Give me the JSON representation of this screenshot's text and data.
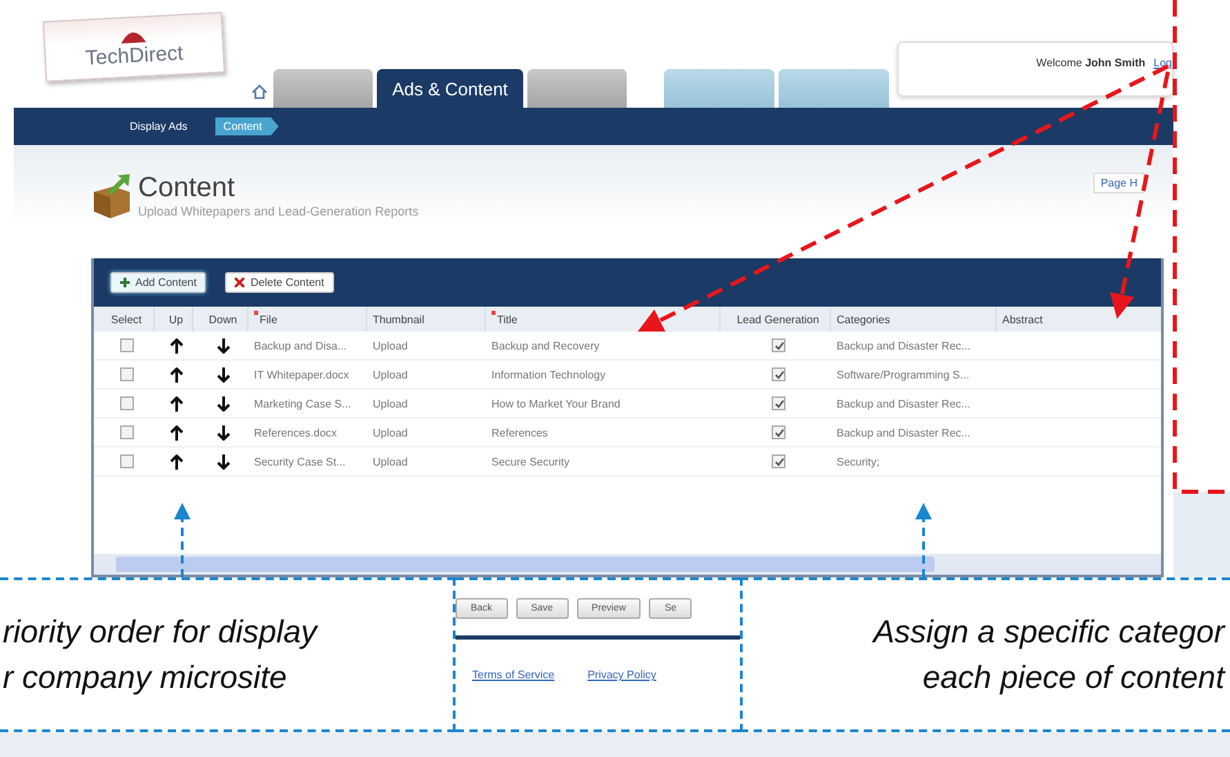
{
  "logo": {
    "text": "TechDirect"
  },
  "tabs": [
    {
      "kind": "grey",
      "selected": false
    },
    {
      "label": "Ads & Content",
      "kind": "grey",
      "selected": true
    },
    {
      "kind": "grey",
      "selected": false
    },
    {
      "kind": "faded",
      "selected": false
    },
    {
      "kind": "faded",
      "selected": false
    }
  ],
  "user_box": {
    "welcome": "Welcome **John Smith**",
    "link": "Log"
  },
  "subnav": [
    {
      "label": "Display Ads",
      "selected": false
    },
    {
      "label": "Content",
      "selected": true
    }
  ],
  "page": {
    "title": "Content",
    "subtitle": "Upload Whitepapers and Lead-Generation Reports",
    "help_link": "Page H"
  },
  "toolbar": [
    {
      "label": "Add Content",
      "kind": "add"
    },
    {
      "label": "Delete Content",
      "kind": "delete"
    }
  ],
  "table": {
    "columns": [
      {
        "label": "Select",
        "required": false
      },
      {
        "label": "Up",
        "required": false
      },
      {
        "label": "Down",
        "required": false
      },
      {
        "label": "File",
        "required": true
      },
      {
        "label": "Thumbnail",
        "required": false
      },
      {
        "label": "Title",
        "required": true
      },
      {
        "label": "Lead Generation",
        "required": false
      },
      {
        "label": "Categories",
        "required": false
      },
      {
        "label": "Abstract",
        "required": false
      }
    ],
    "rows": [
      {
        "checked": false,
        "file": "Backup and Disa...",
        "thumbnail": "Upload",
        "title": "Backup and Recovery",
        "lead_generation": true,
        "categories": "Backup and Disaster Rec..."
      },
      {
        "checked": false,
        "file": "IT Whitepaper.docx",
        "thumbnail": "Upload",
        "title": "Information Technology",
        "lead_generation": true,
        "categories": "Software/Programming S..."
      },
      {
        "checked": false,
        "file": "Marketing Case S...",
        "thumbnail": "Upload",
        "title": "How to Market Your Brand",
        "lead_generation": true,
        "categories": "Backup and Disaster Rec..."
      },
      {
        "checked": false,
        "file": "References.docx",
        "thumbnail": "Upload",
        "title": "References",
        "lead_generation": true,
        "categories": "Backup and Disaster Rec..."
      },
      {
        "checked": false,
        "file": "Security Case St...",
        "thumbnail": "Upload",
        "title": "Secure Security",
        "lead_generation": true,
        "categories": "Security;"
      }
    ]
  },
  "footer_buttons": [
    "Back",
    "Save",
    "Preview",
    "Se"
  ],
  "footer_links": [
    "Terms of Service",
    "Privacy Policy"
  ],
  "callouts": [
    {
      "lines": [
        "riority order for display",
        "r company microsite"
      ]
    },
    {
      "lines": [
        "Assign a specific categor",
        "each piece of content"
      ]
    }
  ]
}
